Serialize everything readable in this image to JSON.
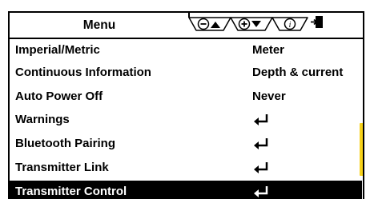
{
  "header": {
    "title": "Menu",
    "buttons": [
      {
        "icon": "minus-up-icon"
      },
      {
        "icon": "plus-down-icon"
      },
      {
        "icon": "info-icon"
      },
      {
        "icon": "exit-icon"
      }
    ]
  },
  "menu": {
    "items": [
      {
        "label": "Imperial/Metric",
        "value": "Meter"
      },
      {
        "label": "Continuous Information",
        "value": "Depth & current"
      },
      {
        "label": "Auto Power Off",
        "value": "Never"
      },
      {
        "label": "Warnings",
        "value": "",
        "icon": "enter-icon"
      },
      {
        "label": "Bluetooth Pairing",
        "value": "",
        "icon": "enter-icon"
      },
      {
        "label": "Transmitter Link",
        "value": "",
        "icon": "enter-icon"
      },
      {
        "label": "Transmitter Control",
        "value": "",
        "icon": "enter-icon",
        "selected": true
      }
    ]
  },
  "scrollbar": {
    "thumb_color": "#f7d21a",
    "position_fraction": 0.62
  }
}
